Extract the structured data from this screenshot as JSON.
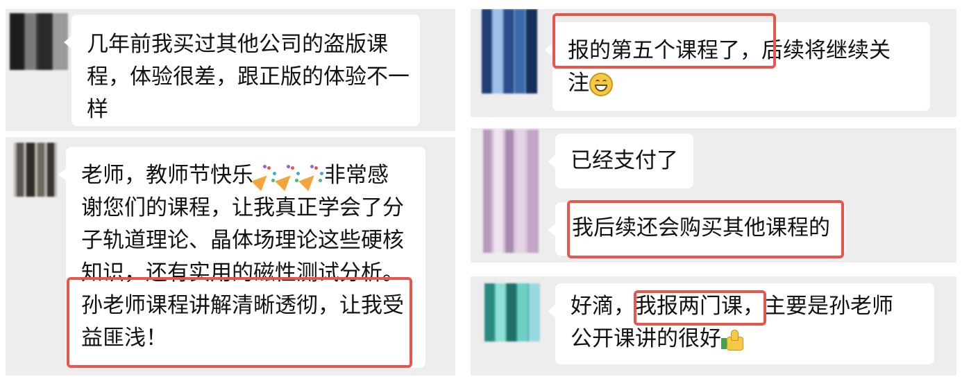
{
  "messages": [
    {
      "id": "m1",
      "lines": [
        "几年前我买过其他公司的盗版课",
        "程，体验很差，跟正版的体验不一",
        "样"
      ]
    },
    {
      "id": "m2",
      "line1_a": "老师，教师节快乐",
      "line1_b": "非常感",
      "lines": [
        "谢您们的课程，让我真正学会了分",
        "子轨道理论、晶体场理论这些硬核",
        "知识，还有实用的磁性测试分析。",
        "孙老师课程讲解清晰透彻，让我受",
        "益匪浅！"
      ]
    },
    {
      "id": "m3",
      "line1": "报的第五个课程了，后续将继续关",
      "line2": "注"
    },
    {
      "id": "m4",
      "text": "已经支付了"
    },
    {
      "id": "m5",
      "text": "我后续还会购买其他课程的"
    },
    {
      "id": "m6",
      "line1_a": "好滴，",
      "line1_b": "我报两门课，",
      "line1_c": "主要是孙老师",
      "line2": "公开课讲的很好"
    }
  ],
  "emojis": {
    "popper": "party-popper-icon",
    "grin": "grinning-face-icon",
    "thumbs": "thumbs-up-icon"
  },
  "colors": {
    "highlight": "#e8564b",
    "panel": "#ededed",
    "bubble": "#ffffff"
  }
}
